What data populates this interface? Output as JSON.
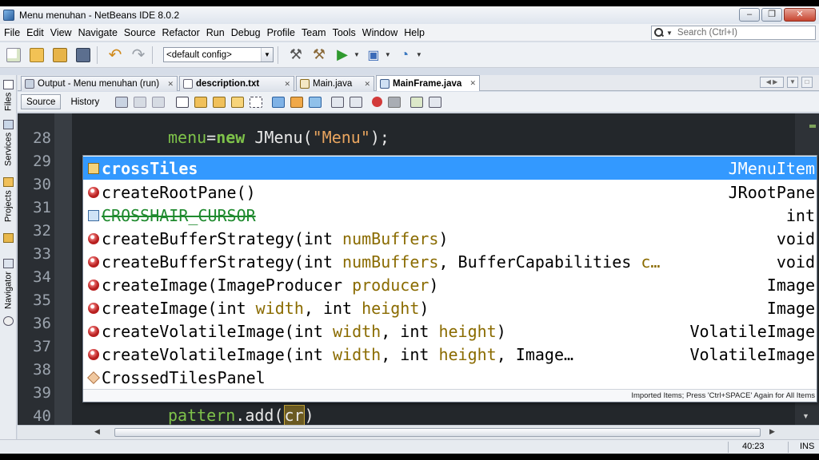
{
  "window": {
    "title": "Menu menuhan - NetBeans IDE 8.0.2",
    "minimize": "–",
    "restore": "❐",
    "close": "✕"
  },
  "menubar": [
    "File",
    "Edit",
    "View",
    "Navigate",
    "Source",
    "Refactor",
    "Run",
    "Debug",
    "Profile",
    "Team",
    "Tools",
    "Window",
    "Help"
  ],
  "search": {
    "placeholder": "Search (Ctrl+I)"
  },
  "toolbar": {
    "config": "<default config>"
  },
  "sidebar": {
    "tabs": [
      "Files",
      "Services",
      "Projects",
      "Navigator"
    ]
  },
  "editor_tabs": [
    {
      "label": "Output - Menu menuhan (run)"
    },
    {
      "label": "description.txt"
    },
    {
      "label": "Main.java"
    },
    {
      "label": "MainFrame.java"
    }
  ],
  "editor_toolbar": {
    "source": "Source",
    "history": "History"
  },
  "line_numbers": [
    "28",
    "29",
    "30",
    "31",
    "32",
    "33",
    "34",
    "35",
    "36",
    "37",
    "38",
    "39",
    "40"
  ],
  "code": {
    "line28": {
      "field": "menu",
      "eq": "=",
      "kw": "new",
      "rest": " JMenu(",
      "str": "\"Menu\"",
      "end": ");"
    },
    "line40": {
      "field": "pattern",
      "mid": ".add(",
      "typed": "cr",
      "end": ")"
    }
  },
  "completion": {
    "items": [
      {
        "name": "crossTiles",
        "type": "JMenuItem"
      },
      {
        "name": "createRootPane()",
        "type": "JRootPane"
      },
      {
        "name": "CROSSHAIR_CURSOR",
        "type": "int"
      },
      {
        "name_pre": "createBufferStrategy(int ",
        "param": "numBuffers",
        "name_post": ")",
        "type": "void"
      },
      {
        "name_pre": "createBufferStrategy(int ",
        "param": "numBuffers",
        "name_mid": ", BufferCapabilities ",
        "param2": "c…",
        "type": "void"
      },
      {
        "name_pre": "createImage(ImageProducer ",
        "param": "producer",
        "name_post": ")",
        "type": "Image"
      },
      {
        "name_pre": "createImage(int ",
        "param": "width",
        "name_mid": ", int ",
        "param2": "height",
        "name_post": ")",
        "type": "Image"
      },
      {
        "name_pre": "createVolatileImage(int ",
        "param": "width",
        "name_mid": ", int ",
        "param2": "height",
        "name_post": ")",
        "type": "VolatileImage"
      },
      {
        "name_pre": "createVolatileImage(int ",
        "param": "width",
        "name_mid": ", int ",
        "param2": "height",
        "name_post": ", Image…",
        "type": "VolatileImage"
      },
      {
        "name": "CrossedTilesPanel",
        "type": ""
      }
    ],
    "footer": "Imported Items; Press 'Ctrl+SPACE' Again for All Items"
  },
  "status": {
    "position": "40:23",
    "mode": "INS"
  }
}
